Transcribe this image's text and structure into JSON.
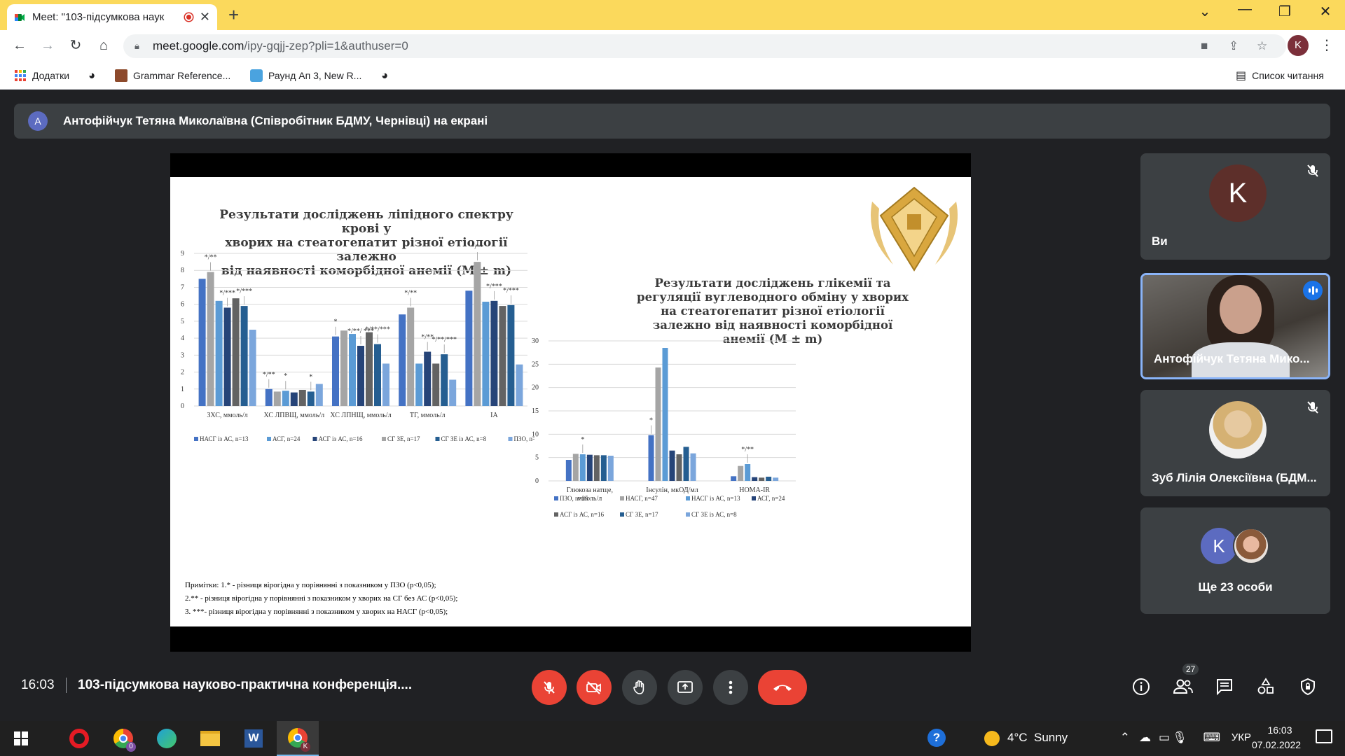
{
  "browser": {
    "tab_title": "Meet: \"103-підсумкова наук",
    "url_host": "meet.google.com",
    "url_path": "/ipy-gqjj-zep?pli=1&authuser=0",
    "profile_letter": "K",
    "bookmarks": [
      "Додатки",
      "Grammar Reference...",
      "Раунд Ап 3, New R..."
    ],
    "reading_list": "Список читання"
  },
  "meet": {
    "presenter_avatar": "A",
    "presenter_text": "Антофійчук Тетяна Миколаївна (Співробітник БДМУ, Чернівці) на екрані",
    "time": "16:03",
    "meeting_title": "103-підсумкова науково-практична конференція....",
    "participants_count": "27",
    "tiles": [
      {
        "name": "Ви",
        "avatar": "K",
        "avatar_color": "#5d2f2a"
      },
      {
        "name": "Антофійчук Тетяна Мико..."
      },
      {
        "name": "Зуб Лілія Олексіївна (БДМ..."
      },
      {
        "name": "Ще 23 особи",
        "avatar": "K",
        "avatar_color": "#5c6bc0"
      }
    ]
  },
  "slide": {
    "left_title": [
      "Результати досліджень ліпідного спектру крові у",
      "хворих на стеатогепатит різної етіології залежно",
      "від наявності коморбідної анемії (M ± m)"
    ],
    "right_title": [
      "Результати досліджень глікемії та",
      "регуляції вуглеводного обміну у хворих",
      "на стеатогепатит різної етіології",
      "залежно від наявності коморбідної",
      "анемії (M ± m)"
    ],
    "notes": [
      "Примітки: 1.* - різниця вірогідна у порівнянні з показником у ПЗО (р<0,05);",
      "2.** - різниця вірогідна у порівнянні з показником у хворих на СГ без АС (р<0,05);",
      "3. ***- різниця вірогідна у порівнянні з показником у хворих на НАСГ (р<0,05);"
    ]
  },
  "chart_data": [
    {
      "type": "bar",
      "ylim": [
        0,
        9
      ],
      "yticks": [
        0,
        1,
        2,
        3,
        4,
        5,
        6,
        7,
        8,
        9
      ],
      "categories": [
        "ЗХС, ммоль/л",
        "ХС ЛПВЩ, ммоль/л",
        "ХС ЛПНЩ, ммоль/л",
        "ТГ, ммоль/л",
        "ІА"
      ],
      "series": [
        {
          "name": "НАСГ із АС, n=13",
          "color": "#4472c4",
          "values": [
            7.5,
            1.0,
            4.1,
            5.4,
            6.8
          ]
        },
        {
          "name": "АСГ, n=24",
          "color": "#a5a5a5",
          "values": [
            7.9,
            0.85,
            4.45,
            5.8,
            8.5
          ]
        },
        {
          "name": "АСГ із АС, n=16",
          "color": "#5b9bd5",
          "values": [
            6.2,
            0.9,
            4.25,
            2.5,
            6.15
          ]
        },
        {
          "name": "СГ ЗЕ, n=17",
          "color": "#264478",
          "values": [
            5.8,
            0.8,
            3.55,
            3.2,
            6.2
          ]
        },
        {
          "name": "СГ ЗЕ із АС, n=8",
          "color": "#636363",
          "values": [
            6.35,
            0.95,
            4.35,
            2.5,
            5.9
          ]
        },
        {
          "name": "ПЗО, n=25",
          "color": "#255e91",
          "values": [
            5.9,
            0.85,
            3.65,
            3.05,
            5.95
          ]
        },
        {
          "name": "",
          "color": "#7ba6dc",
          "values": [
            4.5,
            1.3,
            2.5,
            1.55,
            2.45
          ]
        }
      ],
      "legend_colors": [
        "#4472c4",
        "#5b9bd5",
        "#264478",
        "#a5a5a5",
        "#255e91",
        "#7ba6dc"
      ],
      "legend": [
        "НАСГ із АС, n=13",
        "АСГ, n=24",
        "АСГ із АС, n=16",
        "СГ ЗЕ, n=17",
        "СГ ЗЕ із АС, n=8",
        "ПЗО, n=25"
      ],
      "annotations": [
        {
          "cat": 0,
          "series": 1,
          "text": "*/**"
        },
        {
          "cat": 0,
          "series": 3,
          "text": "*/***"
        },
        {
          "cat": 0,
          "series": 5,
          "text": "*/***"
        },
        {
          "cat": 1,
          "series": 0,
          "text": "*/**"
        },
        {
          "cat": 1,
          "series": 2,
          "text": "*"
        },
        {
          "cat": 1,
          "series": 5,
          "text": "*"
        },
        {
          "cat": 2,
          "series": 0,
          "text": "*"
        },
        {
          "cat": 2,
          "series": 3,
          "text": "*/**/ ***"
        },
        {
          "cat": 2,
          "series": 5,
          "text": "*/**/***"
        },
        {
          "cat": 3,
          "series": 1,
          "text": "*/**"
        },
        {
          "cat": 3,
          "series": 3,
          "text": "*/**"
        },
        {
          "cat": 3,
          "series": 5,
          "text": "*/**/***"
        },
        {
          "cat": 4,
          "series": 1,
          "text": "*/**"
        },
        {
          "cat": 4,
          "series": 3,
          "text": "*/***"
        },
        {
          "cat": 4,
          "series": 5,
          "text": "*/***"
        }
      ]
    },
    {
      "type": "bar",
      "ylim": [
        0,
        30
      ],
      "yticks": [
        0,
        5,
        10,
        15,
        20,
        25,
        30
      ],
      "categories": [
        "Глюкоза натще, ммоль/л",
        "Інсулін, мкОД/мл",
        "HOMA-IR"
      ],
      "series": [
        {
          "name": "ПЗО, n=25",
          "color": "#4472c4",
          "values": [
            4.5,
            9.8,
            1.0
          ]
        },
        {
          "name": "НАСГ, n=47",
          "color": "#a5a5a5",
          "values": [
            5.8,
            24.3,
            3.2
          ]
        },
        {
          "name": "НАСГ із АС, n=13",
          "color": "#5b9bd5",
          "values": [
            5.7,
            28.5,
            3.6
          ]
        },
        {
          "name": "АСГ, n=24",
          "color": "#264478",
          "values": [
            5.6,
            6.5,
            0.8
          ]
        },
        {
          "name": "АСГ із АС, n=16",
          "color": "#636363",
          "values": [
            5.5,
            5.7,
            0.7
          ]
        },
        {
          "name": "СГ ЗЕ, n=17",
          "color": "#255e91",
          "values": [
            5.5,
            7.3,
            0.9
          ]
        },
        {
          "name": "СГ ЗЕ із АС, n=8",
          "color": "#7ba6dc",
          "values": [
            5.4,
            5.9,
            0.7
          ]
        }
      ],
      "annotations": [
        {
          "cat": 0,
          "series": 2,
          "text": "*"
        },
        {
          "cat": 1,
          "series": 0,
          "text": "*"
        },
        {
          "cat": 2,
          "series": 2,
          "text": "*/**"
        }
      ]
    }
  ],
  "taskbar": {
    "weather": "4°C  Sunny",
    "lang": "УКР",
    "clock_time": "16:03",
    "clock_date": "07.02.2022",
    "chrome_badge": "K",
    "chrome2_badge": "0"
  }
}
